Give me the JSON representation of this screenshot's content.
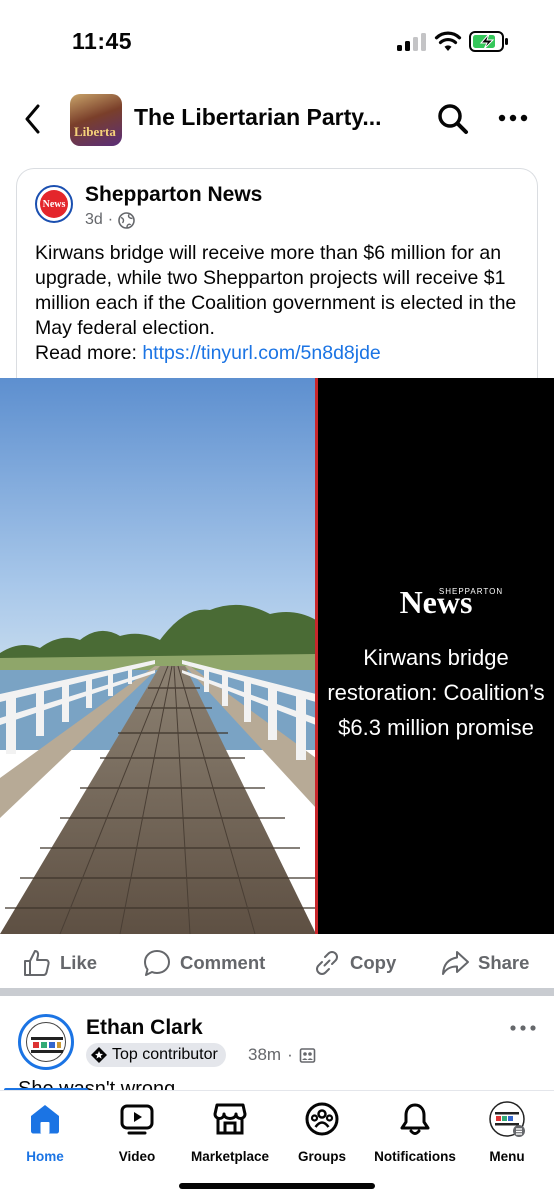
{
  "status_bar": {
    "time": "11:45"
  },
  "header": {
    "title": "The Libertarian Party...",
    "avatar_text": "Liberta"
  },
  "shared_post": {
    "source_name": "Shepparton News",
    "source_avatar_text": "News",
    "time_ago": "3d",
    "separator": "·",
    "body": "Kirwans bridge will receive more than $6 million for an upgrade, while two Shepparton projects will receive $1 million each if the Coalition government is elected in the May federal election.",
    "read_more_label": "Read more:",
    "link": "https://tinyurl.com/5n8d8jde"
  },
  "image_panel": {
    "brand_small": "SHEPPARTON",
    "brand": "News",
    "headline_lines": [
      "Kirwans bridge",
      "restoration: Coalition’s",
      "$6.3 million promise"
    ]
  },
  "actions": {
    "like": "Like",
    "comment": "Comment",
    "copy": "Copy",
    "share": "Share"
  },
  "next_post": {
    "author": "Ethan Clark",
    "badge": "Top contributor",
    "time_ago": "38m",
    "separator": "·",
    "text_partial": "She wasn't wrong"
  },
  "tabs": [
    {
      "label": "Home",
      "icon": "home-icon",
      "active": true
    },
    {
      "label": "Video",
      "icon": "video-icon"
    },
    {
      "label": "Marketplace",
      "icon": "marketplace-icon"
    },
    {
      "label": "Groups",
      "icon": "groups-icon"
    },
    {
      "label": "Notifications",
      "icon": "bell-icon"
    },
    {
      "label": "Menu",
      "icon": "profile-menu-icon"
    }
  ],
  "colors": {
    "accent": "#1b74e4",
    "news_red": "#e4262b",
    "muted": "#65676b"
  }
}
